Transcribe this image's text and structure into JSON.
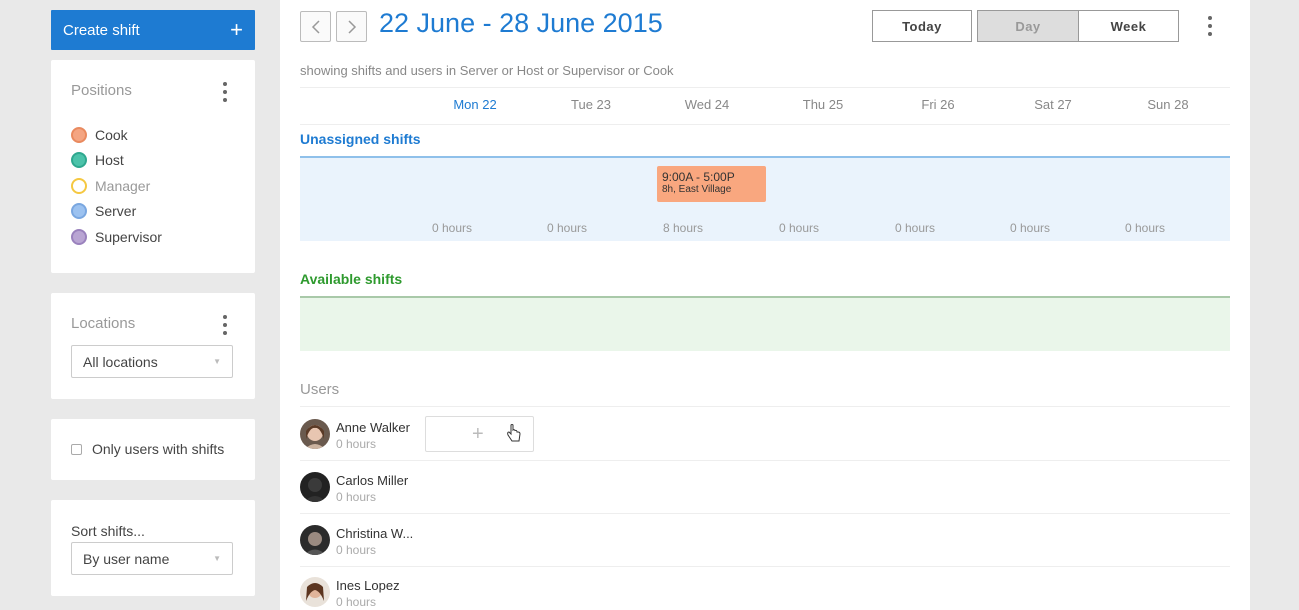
{
  "sidebar": {
    "create_label": "Create shift",
    "create_icon": "plus-icon",
    "positions": {
      "title": "Positions",
      "items": [
        {
          "label": "Cook",
          "color": "#f4a582",
          "border": "#e98a5f",
          "dim": false
        },
        {
          "label": "Host",
          "color": "#4cc3aa",
          "border": "#2fa88f",
          "dim": false
        },
        {
          "label": "Manager",
          "color": "#ffffff",
          "border": "#f5c842",
          "dim": true
        },
        {
          "label": "Server",
          "color": "#9cc2f0",
          "border": "#7aa7e0",
          "dim": false
        },
        {
          "label": "Supervisor",
          "color": "#b9a5d3",
          "border": "#9a82bd",
          "dim": false
        }
      ]
    },
    "locations": {
      "title": "Locations",
      "selected": "All locations"
    },
    "only_users_with_shifts": {
      "label": "Only users with shifts",
      "checked": false
    },
    "sort": {
      "title": "Sort shifts...",
      "selected": "By user name"
    }
  },
  "header": {
    "date_range": "22 June - 28 June 2015",
    "today_label": "Today",
    "day_label": "Day",
    "week_label": "Week",
    "active_view": "Day"
  },
  "filter_text": "showing shifts and users in Server or Host or Supervisor or Cook",
  "days": [
    "Mon 22",
    "Tue 23",
    "Wed 24",
    "Thu 25",
    "Fri 26",
    "Sat 27",
    "Sun 28"
  ],
  "today_index": 0,
  "unassigned": {
    "label": "Unassigned shifts",
    "shift": {
      "time": "9:00A - 5:00P",
      "details": "8h, East Village"
    },
    "hours": [
      "0 hours",
      "0 hours",
      "8 hours",
      "0 hours",
      "0 hours",
      "0 hours",
      "0 hours"
    ]
  },
  "available": {
    "label": "Available shifts"
  },
  "users": {
    "label": "Users",
    "list": [
      {
        "name": "Anne Walker",
        "hours": "0 hours"
      },
      {
        "name": "Carlos Miller",
        "hours": "0 hours"
      },
      {
        "name": "Christina W...",
        "hours": "0 hours"
      },
      {
        "name": "Ines Lopez",
        "hours": "0 hours"
      }
    ]
  },
  "colors": {
    "accent": "#1e7bd2",
    "unassigned_bg": "#eaf3fc",
    "available_bg": "#eaf6ea",
    "available_label": "#2e9a2e",
    "shift_card": "#f9a77f"
  }
}
